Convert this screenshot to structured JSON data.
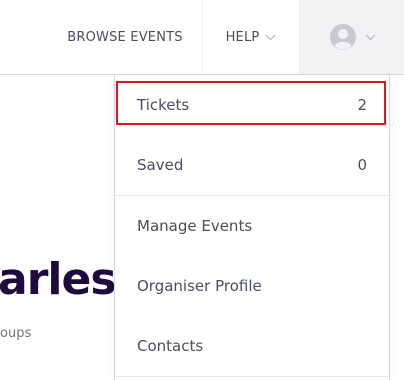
{
  "navbar": {
    "browse_events_label": "BROWSE EVENTS",
    "help_label": "HELP",
    "account_icon": "user-avatar-icon",
    "chevron_icon": "chevron-down-icon"
  },
  "hero": {
    "title_fragment": "arles",
    "subtitle_fragment": "oups"
  },
  "dropdown": {
    "items": [
      {
        "label": "Tickets",
        "count": "2"
      },
      {
        "label": "Saved",
        "count": "0"
      },
      {
        "label": "Manage Events"
      },
      {
        "label": "Organiser Profile"
      },
      {
        "label": "Contacts"
      }
    ]
  },
  "colors": {
    "text": "#4b4d63",
    "heading": "#1e0a3c",
    "highlight_border": "#e0141e",
    "account_bg": "#f2f2f5"
  }
}
